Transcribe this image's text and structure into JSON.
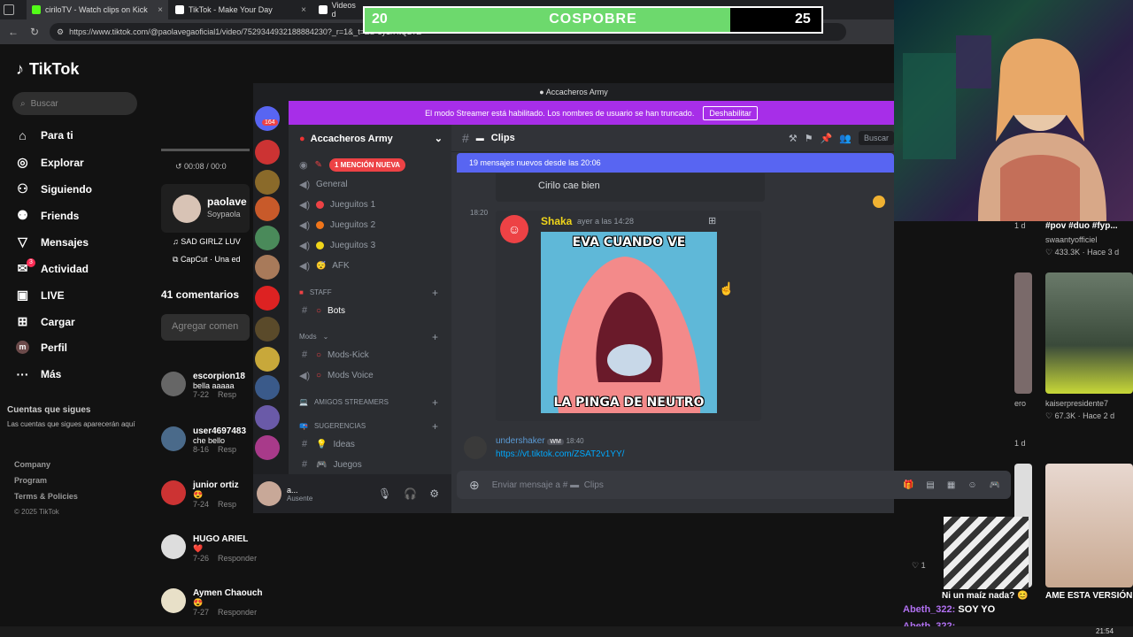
{
  "browser": {
    "tabs": [
      {
        "label": "ciriloTV - Watch clips on Kick",
        "icon_color": "#53fc18"
      },
      {
        "label": "TikTok - Make Your Day",
        "icon_color": "#ffffff"
      },
      {
        "label": "Videos d",
        "icon_color": "#ffffff"
      }
    ],
    "url": "https://www.tiktok.com/@paolavegaoficial1/video/7529344932188884230?_r=1&_t=ZS-8y1rHtQ2TZ"
  },
  "goal": {
    "left": "20",
    "label": "COSPOBRE",
    "right": "25",
    "fill_fraction": 0.8
  },
  "tiktok": {
    "logo": "TikTok",
    "search_placeholder": "Buscar",
    "nav": [
      {
        "label": "Para ti",
        "icon": "home-icon"
      },
      {
        "label": "Explorar",
        "icon": "compass-icon"
      },
      {
        "label": "Siguiendo",
        "icon": "following-icon"
      },
      {
        "label": "Friends",
        "icon": "friends-icon"
      },
      {
        "label": "Mensajes",
        "icon": "messages-icon"
      },
      {
        "label": "Actividad",
        "icon": "activity-icon"
      },
      {
        "label": "LIVE",
        "icon": "live-icon"
      },
      {
        "label": "Cargar",
        "icon": "upload-icon"
      },
      {
        "label": "Perfil",
        "icon": "profile-icon"
      },
      {
        "label": "Más",
        "icon": "more-icon"
      }
    ],
    "activity_badge": "3",
    "following_title": "Cuentas que sigues",
    "following_desc": "Las cuentas que sigues aparecerán aquí",
    "footer": [
      "Company",
      "Program",
      "Terms & Policies",
      "© 2025 TikTok"
    ],
    "video_time": "00:08 / 00:0",
    "author_name": "paolave",
    "author_handle": "Soypaola",
    "sound": "SAD GIRLZ LUV",
    "capcut": "CapCut · Una ed",
    "comments_count": "41 comentarios",
    "add_comment": "Agregar comen",
    "comments": [
      {
        "user": "escorpion18",
        "text": "bella aaaaa",
        "date": "7-22",
        "reply": "Resp"
      },
      {
        "user": "user4697483",
        "text": "che bello",
        "date": "8-16",
        "reply": "Resp"
      },
      {
        "user": "junior ortiz",
        "text": "😍",
        "date": "7-24",
        "reply": "Resp"
      },
      {
        "user": "HUGO ARIEL",
        "text": "❤️",
        "date": "7-26",
        "reply": "Responder"
      },
      {
        "user": "Aymen Chaouch",
        "text": "😍",
        "date": "7-27",
        "reply": "Responder"
      }
    ],
    "right_feed": [
      {
        "title": "#pov #duo #fyp...",
        "user": "swaantyofficiel",
        "meta": "433.3K · Hace 3 d"
      },
      {
        "title": "",
        "user": "kaiserpresidente7",
        "meta": "67.3K · Hace 2 d"
      },
      {
        "title": "AME ESTA VERSIÓN",
        "user": "",
        "meta": ""
      }
    ],
    "side_labels": [
      "1 d",
      "ero",
      "1 d"
    ],
    "like_count": "1",
    "bottom_caption": "Ni un maíz nada? 😊"
  },
  "discord": {
    "top_title": "Accacheros Army",
    "banner_text": "El modo Streamer está habilitado. Los nombres de usuario se han truncado.",
    "banner_button": "Deshabilitar",
    "server_name": "Accacheros Army",
    "mention_badge": "1 MENCIÓN NUEVA",
    "guild_badge": "164",
    "channels": [
      {
        "type": "voice",
        "dot": "",
        "label": "General"
      },
      {
        "type": "voice",
        "dot": "#ed4245",
        "label": "Jueguitos 1"
      },
      {
        "type": "voice",
        "dot": "#f0751a",
        "label": "Jueguitos 2"
      },
      {
        "type": "voice",
        "dot": "#f0d51a",
        "label": "Jueguitos 3"
      },
      {
        "type": "voice",
        "dot": "😴",
        "label": "AFK"
      }
    ],
    "cat_staff": "STAFF",
    "ch_bots": "Bots",
    "cat_mods": "Mods",
    "ch_mods_kick": "Mods-Kick",
    "ch_mods_voice": "Mods Voice",
    "cat_amigos": "AMIGOS STREAMERS",
    "cat_sugerencias": "SUGERENCIAS",
    "ch_ideas": "Ideas",
    "ch_juegos": "Juegos",
    "user_name": "a...",
    "user_status": "Ausente",
    "chat_channel": "Clips",
    "search_placeholder": "Buscar",
    "new_messages": "19 mensajes nuevos desde las 20:06",
    "prev_message": "Cirilo cae bien",
    "msg_time": "18:20",
    "msg_author": "Shaka",
    "msg_timestamp": "ayer a las 14:28",
    "meme_top": "EVA CUANDO VE",
    "meme_bottom": "LA PINGA DE NEUTRO",
    "second_author": "undershaker",
    "second_tag": "WM",
    "second_time": "18:40",
    "second_link": "https://vt.tiktok.com/ZSAT2v1YY/",
    "input_placeholder": "Enviar mensaje a #",
    "input_channel": "Clips"
  },
  "stream_chat": [
    {
      "user": "Abeth_322",
      "text": "SOY YO"
    },
    {
      "user": "Abeth_322",
      "text": ""
    }
  ],
  "clock": "21:54"
}
